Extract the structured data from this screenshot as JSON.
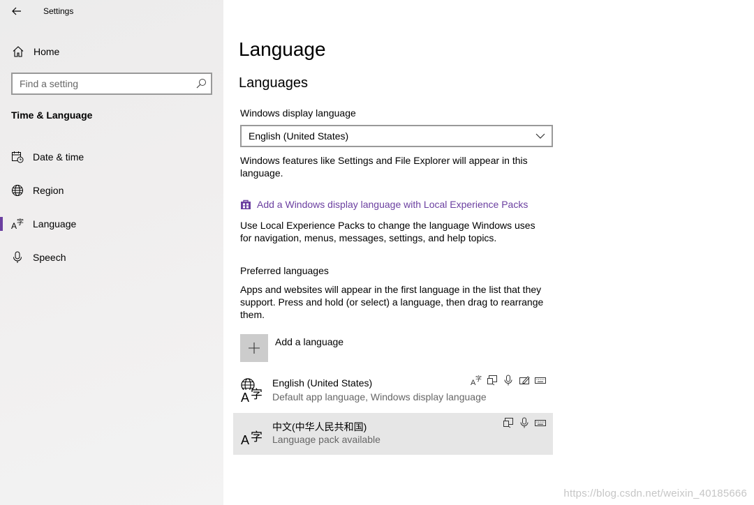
{
  "window": {
    "title": "Settings"
  },
  "sidebar": {
    "home_label": "Home",
    "search": {
      "placeholder": "Find a setting",
      "value": ""
    },
    "section_title": "Time & Language",
    "items": [
      {
        "label": "Date & time",
        "icon": "calendar-clock-icon"
      },
      {
        "label": "Region",
        "icon": "globe-icon"
      },
      {
        "label": "Language",
        "icon": "language-icon",
        "active": true
      },
      {
        "label": "Speech",
        "icon": "microphone-icon"
      }
    ],
    "accent_color": "#6b3fa0"
  },
  "main": {
    "page_title": "Language",
    "section_title": "Languages",
    "display_language": {
      "label": "Windows display language",
      "selected": "English (United States)",
      "description": "Windows features like Settings and File Explorer will appear in this language."
    },
    "lep_link": {
      "label": "Add a Windows display language with Local Experience Packs",
      "icon": "store-bag-icon",
      "description": "Use Local Experience Packs to change the language Windows uses for navigation, menus, messages, settings, and help topics."
    },
    "preferred": {
      "label": "Preferred languages",
      "description": "Apps and websites will appear in the first language in the list that they support. Press and hold (or select) a language, then drag to rearrange them.",
      "add_label": "Add a language",
      "languages": [
        {
          "name": "English (United States)",
          "sub": "Default app language, Windows display language",
          "features": [
            "display-language-icon",
            "text-to-speech-icon",
            "speech-recognition-icon",
            "handwriting-icon",
            "keyboard-icon"
          ]
        },
        {
          "name": "中文(中华人民共和国)",
          "sub": "Language pack available",
          "features": [
            "text-to-speech-icon",
            "speech-recognition-icon",
            "keyboard-icon"
          ],
          "selected": true
        }
      ]
    }
  },
  "watermark": "https://blog.csdn.net/weixin_40185666"
}
